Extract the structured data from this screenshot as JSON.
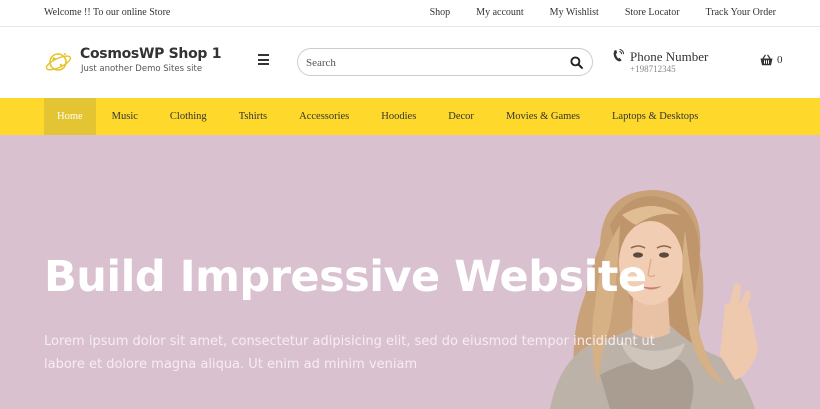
{
  "topbar": {
    "welcome": "Welcome !! To our online Store",
    "links": [
      "Shop",
      "My account",
      "My Wishlist",
      "Store Locator",
      "Track Your Order"
    ]
  },
  "header": {
    "site_title": "CosmosWP Shop 1",
    "tagline": "Just another Demo Sites site",
    "search_placeholder": "Search",
    "phone_label": "Phone Number",
    "phone_number": "+198712345",
    "cart_count": "0"
  },
  "nav": {
    "items": [
      "Home",
      "Music",
      "Clothing",
      "Tshirts",
      "Accessories",
      "Hoodies",
      "Decor",
      "Movies & Games",
      "Laptops & Desktops"
    ],
    "active": "Home"
  },
  "hero": {
    "title": "Build Impressive Website",
    "text": "Lorem ipsum dolor sit amet, consectetur adipisicing elit, sed do eiusmod tempor incididunt ut labore et dolore magna aliqua. Ut enim ad minim veniam"
  },
  "colors": {
    "nav_bg": "#fed92b",
    "nav_active_bg": "#e3c432",
    "hero_bg": "#d9c1d0"
  },
  "icons": {
    "logo": "planet-logo-icon",
    "menu": "hamburger-icon",
    "search": "search-icon",
    "phone": "phone-icon",
    "cart": "basket-icon"
  }
}
